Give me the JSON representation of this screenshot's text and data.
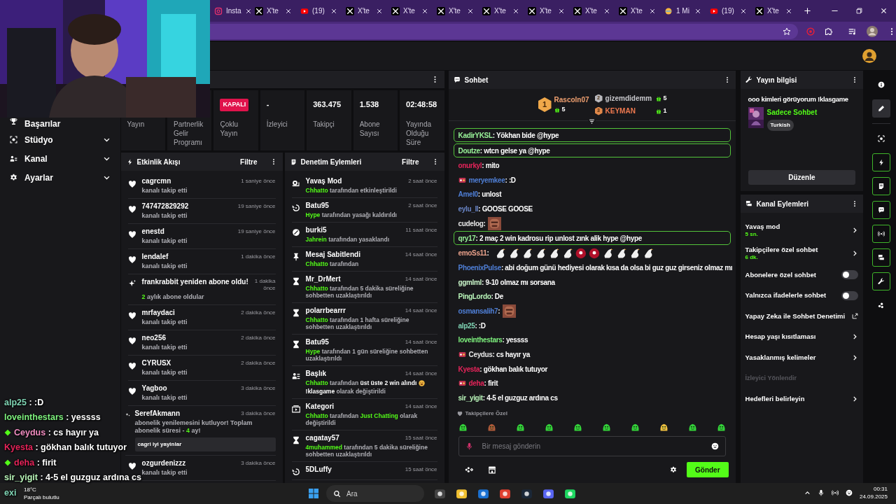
{
  "browser": {
    "tabs": [
      {
        "kind": "instagram",
        "label": "Insta"
      },
      {
        "kind": "x",
        "label": "X'te"
      },
      {
        "kind": "youtube",
        "label": "(19)"
      },
      {
        "kind": "x",
        "label": "X'te"
      },
      {
        "kind": "x",
        "label": "X'te"
      },
      {
        "kind": "x",
        "label": "X'te"
      },
      {
        "kind": "x",
        "label": "X'te"
      },
      {
        "kind": "x",
        "label": "X'te"
      },
      {
        "kind": "x",
        "label": "X'te"
      },
      {
        "kind": "x",
        "label": "X'te"
      },
      {
        "kind": "other",
        "label": "1 Mi"
      },
      {
        "kind": "youtube",
        "label": "(19)"
      },
      {
        "kind": "x",
        "label": "X'te"
      }
    ]
  },
  "sidebar": {
    "items": [
      {
        "kind": "trophy",
        "label": "Başarılar",
        "expandable": false
      },
      {
        "kind": "focus",
        "label": "Stüdyo",
        "expandable": true
      },
      {
        "kind": "people",
        "label": "Kanal",
        "expandable": true
      },
      {
        "kind": "gear",
        "label": "Ayarlar",
        "expandable": true
      }
    ]
  },
  "stats": [
    {
      "label": "Yayın"
    },
    {
      "label": "Partnerlik Gelir Programı"
    },
    {
      "badge": "KAPALI",
      "label": "Çoklu Yayın"
    },
    {
      "value": "-",
      "label": "İzleyici"
    },
    {
      "value": "363.475",
      "label": "Takipçi"
    },
    {
      "value": "1.538",
      "label": "Abone Sayısı"
    },
    {
      "value": "02:48:58",
      "label": "Yayında Olduğu Süre"
    }
  ],
  "activity": {
    "title": "Etkinlik Akışı",
    "filter": "Filtre",
    "items": [
      {
        "kind": "follow",
        "user": "cagrcmn",
        "action": "kanalı takip etti",
        "time": "1 saniye önce"
      },
      {
        "kind": "follow",
        "user": "747472829292",
        "action": "kanalı takip etti",
        "time": "19 saniye önce"
      },
      {
        "kind": "follow",
        "user": "enestd",
        "action": "kanalı takip etti",
        "time": "19 saniye önce"
      },
      {
        "kind": "follow",
        "user": "lendalef",
        "action": "kanalı takip etti",
        "time": "1 dakika önce"
      },
      {
        "kind": "resub",
        "user": "frankrabbit yeniden abone oldu!",
        "count": "2",
        "action": "aylık abone oldular",
        "time": "1 dakika önce"
      },
      {
        "kind": "follow",
        "user": "mrfaydaci",
        "action": "kanalı takip etti",
        "time": "2 dakika önce"
      },
      {
        "kind": "follow",
        "user": "neo256",
        "action": "kanalı takip etti",
        "time": "2 dakika önce"
      },
      {
        "kind": "follow",
        "user": "CYRUSX",
        "action": "kanalı takip etti",
        "time": "2 dakika önce"
      },
      {
        "kind": "follow",
        "user": "Yagboo",
        "action": "kanalı takip etti",
        "time": "3 dakika önce"
      },
      {
        "kind": "sub_message",
        "user": "SerefAkmann",
        "action": "abonelik yenilemesini kutluyor! Toplam abonelik süresi -",
        "count": "4",
        "action_after": "ay!",
        "message": "cagri iyi yayinlar",
        "time": "3 dakika önce"
      },
      {
        "kind": "follow",
        "user": "ozgurdenizzz",
        "action": "kanalı takip etti",
        "time": "3 dakika önce"
      }
    ]
  },
  "moderation": {
    "title": "Denetim Eylemleri",
    "filter": "Filtre",
    "items": [
      {
        "kind": "slow_mode",
        "title": "Yavaş Mod",
        "actor": "Chhatto",
        "text": "tarafından etkinleştirildi",
        "emoji": false,
        "time": "2 saat önce"
      },
      {
        "kind": "unban",
        "title": "Batu95",
        "actor": "Hype",
        "text": "tarafından yasağı kaldırıldı",
        "emoji": false,
        "time": "2 saat önce"
      },
      {
        "kind": "ban",
        "title": "burki5",
        "actor": "Jahrein",
        "text": "tarafından yasaklandı",
        "emoji": false,
        "time": "11 saat önce"
      },
      {
        "kind": "pin",
        "title": "Mesaj Sabitlendi",
        "actor": "Chhatto",
        "text": "tarafından",
        "emoji": false,
        "time": "14 saat önce"
      },
      {
        "kind": "timeout",
        "title": "Mr_DrMert",
        "actor": "Chhatto",
        "text": "tarafından 5 dakika süreliğine sohbetten uzaklaştırıldı",
        "emoji": false,
        "time": "14 saat önce"
      },
      {
        "kind": "timeout",
        "title": "polarrbearrr",
        "actor": "Chhatto",
        "text": "tarafından 1 hafta süreliğine sohbetten uzaklaştırıldı",
        "emoji": false,
        "time": "14 saat önce"
      },
      {
        "kind": "timeout",
        "title": "Batu95",
        "actor": "Hype",
        "text": "tarafından 1 gün süreliğine sohbetten uzaklaştırıldı",
        "emoji": false,
        "time": "14 saat önce"
      },
      {
        "kind": "title",
        "title": "Başlık",
        "actor": "Chhatto",
        "text": "tarafından **üst üste 2 win alındı**",
        "emoji": true,
        "text_after": "**!klasgame** olarak değiştirildi",
        "time": "14 saat önce"
      },
      {
        "kind": "category",
        "title": "Kategori",
        "actor": "Chhatto",
        "text": "tarafından",
        "value": "Just Chatting",
        "text_after": "olarak değiştirildi",
        "emoji": false,
        "time": "14 saat önce"
      },
      {
        "kind": "timeout",
        "title": "cagatay57",
        "actor": "4muhammed",
        "text": "tarafından 5 dakika süreliğine sohbetten uzaklaştırıldı",
        "emoji": false,
        "time": "15 saat önce"
      },
      {
        "kind": "unban",
        "title": "5DLuffy",
        "time": "15 saat önce"
      }
    ]
  },
  "chat": {
    "title": "Sohbet",
    "gifters": [
      {
        "rank": "1",
        "user": "Rascoln07",
        "count": "5"
      },
      {
        "rank": "2",
        "user": "gizemdidemm",
        "count": "5"
      },
      {
        "rank": "3",
        "user": "KEYMAN",
        "count": "1"
      }
    ],
    "messages": [
      {
        "kind": "text",
        "user": "KadirYKSL",
        "color": "#9af59a",
        "text": ": Yökhan bide @hype",
        "highlighted": true,
        "badge": false
      },
      {
        "kind": "text",
        "user": "Doutze",
        "color": "#9af59a",
        "text": ": wtcn gelse ya @hype",
        "highlighted": true,
        "badge": false
      },
      {
        "kind": "text",
        "user": "onurkyl",
        "color": "#e5245a",
        "text": ": mito",
        "highlighted": false,
        "badge": false
      },
      {
        "kind": "text",
        "user": "meryemkee",
        "color": "#4f7fd6",
        "text": ": :D",
        "highlighted": false,
        "badge": true
      },
      {
        "kind": "text",
        "user": "Amel0",
        "color": "#4f7fd6",
        "text": ": unlost",
        "highlighted": false,
        "badge": false
      },
      {
        "kind": "text",
        "user": "eylu_ll",
        "color": "#6a86c8",
        "text": ": GOOSE GOOSE",
        "highlighted": false,
        "badge": false
      },
      {
        "kind": "emote",
        "user": "cudelog",
        "color": "#e6e6e6",
        "text": ":",
        "highlighted": false,
        "badge": false
      },
      {
        "kind": "text",
        "user": "qry17",
        "color": "#9af59a",
        "text": ": 2 maç 2 win kadrosu rip unlost zınk alik hype @hype",
        "highlighted": true,
        "badge": false
      },
      {
        "kind": "emote_row",
        "user": "emoSs11",
        "color": "#e8a08a",
        "text": ":",
        "highlighted": false,
        "badge": false
      },
      {
        "kind": "text",
        "user": "PhoenixPulse",
        "color": "#4f7fd6",
        "text": ": abi doğum günü hediyesi olarak kısa da olsa bi guz guz girseniz olmaz mı",
        "highlighted": false,
        "badge": false
      },
      {
        "kind": "text",
        "user": "ggmlml",
        "color": "#c9f5c9",
        "text": ": 9-10 olmaz mı sorsana",
        "highlighted": false,
        "badge": false
      },
      {
        "kind": "text",
        "user": "PingLordo",
        "color": "#b9f5b9",
        "text": ": De",
        "highlighted": false,
        "badge": false
      },
      {
        "kind": "emote",
        "user": "osmansalih7",
        "color": "#4f7fd6",
        "text": ":",
        "highlighted": false,
        "badge": false
      },
      {
        "kind": "text",
        "user": "alp25",
        "color": "#7fd4b4",
        "text": ": :D",
        "highlighted": false,
        "badge": false
      },
      {
        "kind": "text",
        "user": "loveinthestars",
        "color": "#7df07d",
        "text": ": yessss",
        "highlighted": false,
        "badge": false
      },
      {
        "kind": "text",
        "user": "Ceydus",
        "color": "#e6e6e6",
        "text": ": cs hayır ya",
        "highlighted": false,
        "badge": true
      },
      {
        "kind": "text",
        "user": "Kyesta",
        "color": "#e5245a",
        "text": ": gökhan balık tutuyor",
        "highlighted": false,
        "badge": false
      },
      {
        "kind": "text",
        "user": "deha",
        "color": "#e5245a",
        "text": ": firit",
        "highlighted": false,
        "badge": true
      },
      {
        "kind": "text",
        "user": "sir_yigit",
        "color": "#b9f5b9",
        "text": ": 4-5 el guzguz ardına cs",
        "highlighted": false,
        "badge": false
      }
    ],
    "emote_section": "Takipçilere Özel",
    "input": {
      "placeholder": "Bir mesaj gönderin"
    },
    "send": "Gönder"
  },
  "stream_info": {
    "title": "Yayın bilgisi",
    "stream_title": "ooo kimleri görüyorum !klasgame",
    "category": "Sadece Sohbet",
    "tag": "Turkish",
    "edit": "Düzenle"
  },
  "channel_actions": {
    "title": "Kanal Eylemleri",
    "items": [
      {
        "kind": "link",
        "label": "Yavaş mod",
        "value": "5 sn."
      },
      {
        "kind": "link",
        "label": "Takipçilere özel sohbet",
        "value": "6 dk."
      },
      {
        "kind": "toggle",
        "label": "Abonelere özel sohbet",
        "on": false
      },
      {
        "kind": "toggle",
        "label": "Yalnızca ifadelerle sohbet",
        "on": false
      },
      {
        "kind": "external",
        "label": "Yapay Zeka ile Sohbet Denetimi"
      },
      {
        "kind": "link",
        "label": "Hesap yaşı kısıtlaması"
      },
      {
        "kind": "link",
        "label": "Yasaklanmış kelimeler"
      },
      {
        "kind": "section",
        "label": "İzleyici Yönlendir"
      },
      {
        "kind": "link",
        "label": "Hedefleri belirleyin"
      }
    ]
  },
  "rail": [
    {
      "kind": "info",
      "selected": false,
      "pinned": false
    },
    {
      "kind": "pencil",
      "selected": true,
      "pinned": false
    },
    {
      "kind": "focus",
      "selected": false,
      "pinned": false
    },
    {
      "kind": "bolt",
      "selected": false,
      "pinned": true
    },
    {
      "kind": "note",
      "selected": false,
      "pinned": true
    },
    {
      "kind": "chat",
      "selected": false,
      "pinned": true
    },
    {
      "kind": "broadcast",
      "selected": false,
      "pinned": true
    },
    {
      "kind": "camera",
      "selected": false,
      "pinned": true
    },
    {
      "kind": "wrench",
      "selected": false,
      "pinned": true
    },
    {
      "kind": "dots",
      "selected": false,
      "pinned": false
    }
  ],
  "overlay_chat": [
    {
      "user": "alp25",
      "color": "#7fd4b4",
      "text": ": :D",
      "badge": false
    },
    {
      "user": "loveinthestars",
      "color": "#7df07d",
      "text": ": yessss",
      "badge": false
    },
    {
      "user": "Ceydus",
      "color": "#f08cc0",
      "text": ": cs hayır ya",
      "badge": true
    },
    {
      "user": "Kyesta",
      "color": "#e5245a",
      "text": ": gökhan balık tutuyor",
      "badge": false
    },
    {
      "user": "deha",
      "color": "#e5245a",
      "text": ": firit",
      "badge": true
    },
    {
      "user": "sir_yigit",
      "color": "#b9f5b9",
      "text": ": 4-5 el guzguz ardına cs",
      "badge": false
    },
    {
      "user": "exi",
      "color": "#7fd4b4",
      "badge": false
    }
  ],
  "taskbar": {
    "weather_temp": "18°C",
    "weather_text": "Parçalı bulutlu",
    "search": "Ara",
    "time": "00:31",
    "date": "24.09.2025"
  }
}
